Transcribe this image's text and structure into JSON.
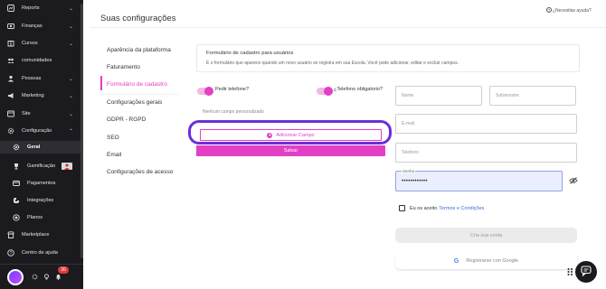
{
  "sidebar": {
    "items": [
      {
        "label": "Reports",
        "icon": "reports-icon",
        "chevron": "⌄"
      },
      {
        "label": "Finanças",
        "icon": "finance-icon",
        "chevron": "⌄"
      },
      {
        "label": "Cursos",
        "icon": "courses-icon",
        "chevron": "⌄"
      },
      {
        "label": "comunidades",
        "icon": "community-icon",
        "chevron": ""
      },
      {
        "label": "Pessoas",
        "icon": "people-icon",
        "chevron": "⌄"
      },
      {
        "label": "Marketing",
        "icon": "marketing-icon",
        "chevron": "⌄"
      },
      {
        "label": "Site",
        "icon": "site-icon",
        "chevron": "⌄"
      },
      {
        "label": "Configuração",
        "icon": "settings-icon",
        "chevron": "⌃"
      }
    ],
    "subitems": [
      {
        "label": "Geral",
        "icon": "gear-icon"
      },
      {
        "label": "Gamificação",
        "icon": "trophy-icon"
      },
      {
        "label": "Pagamentos",
        "icon": "card-icon"
      },
      {
        "label": "Integrações",
        "icon": "integrations-icon"
      },
      {
        "label": "Planos",
        "icon": "plans-icon"
      }
    ],
    "bottom_items": [
      {
        "label": "Marketplace",
        "icon": "marketplace-icon"
      },
      {
        "label": "Centro de ajuda",
        "icon": "help-icon"
      }
    ],
    "notification_count": "36"
  },
  "header": {
    "title": "Suas configurações",
    "help_link": "¿Necesitas ayuda?"
  },
  "settings_menu": [
    "Aparência da plataforma",
    "Faturamento",
    "Formulário de cadastro",
    "Configurações gerais",
    "GDPR - RGPD",
    "SEO",
    "Email",
    "Configurações de acesso"
  ],
  "active_menu": "Formulário de cadastro",
  "form_card": {
    "title": "Formulário de cadastro para usuários",
    "description": "É o formulário que aparece quando um novo usuário se registra em sua Escola. Você pode adicionar, editar e excluir campos."
  },
  "toggles": {
    "phone_label": "Pedir telefone?",
    "phone_on": true,
    "phone_required_label": "¿Telefono obligatorio?",
    "phone_required_on": true
  },
  "fields": {
    "empty_text": "Nenhum campo personalizado",
    "add_button": "Adicionar Campo",
    "save_button": "Salvar"
  },
  "preview": {
    "name_placeholder": "Nome",
    "surname_placeholder": "Sobrenome",
    "email_placeholder": "E-mail",
    "phone_placeholder": "Telefono",
    "password_label": "Senha",
    "password_value": "••••••••••••",
    "terms_prefix": "Eu os aceito",
    "terms_link": "Termos e Condições",
    "create_button": "Cria sua conta",
    "google_button": "Registrarse con Google"
  },
  "colors": {
    "accent": "#e23fc5",
    "highlight": "#6a2fd8",
    "sidebar_bg": "#1b1b1f"
  }
}
